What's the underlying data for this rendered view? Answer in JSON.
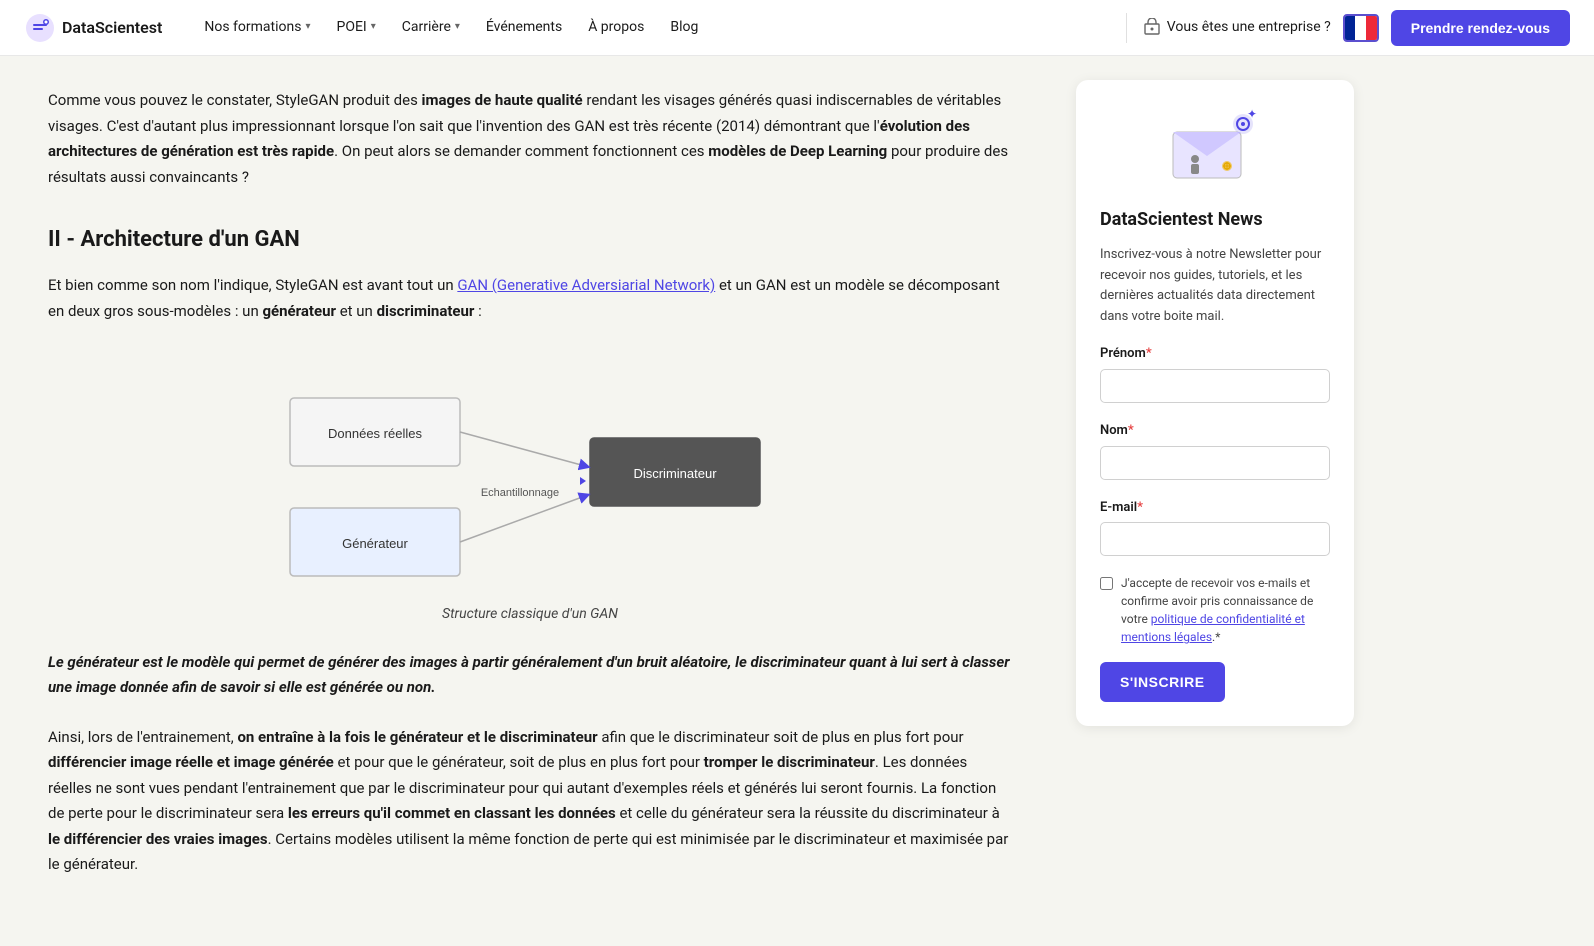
{
  "navbar": {
    "logo_text": "DataScientest",
    "nav_items": [
      {
        "label": "Nos formations",
        "has_dropdown": true
      },
      {
        "label": "POEI",
        "has_dropdown": true
      },
      {
        "label": "Carrière",
        "has_dropdown": true
      },
      {
        "label": "Événements",
        "has_dropdown": false
      },
      {
        "label": "À propos",
        "has_dropdown": false
      },
      {
        "label": "Blog",
        "has_dropdown": false
      }
    ],
    "enterprise_label": "Vous êtes une entreprise ?",
    "cta_label": "Prendre rendez-vous"
  },
  "article": {
    "intro": "Comme vous pouvez le constater, StyleGAN produit des images de haute qualité rendant les visages générés quasi indiscernables de véritables visages. C'est d'autant plus impressionnant lorsque l'on sait que l'invention des GAN est très récente (2014) démontrant que l'évolution des architectures de génération est très rapide. On peut alors se demander comment fonctionnent ces modèles de Deep Learning pour produire des résultats aussi convaincants ?",
    "section_title": "II - Architecture d'un GAN",
    "section_text_1_part1": "Et bien comme son nom l'indique, StyleGAN est avant tout un ",
    "section_text_1_link": "GAN (Generative Adversiarial Network)",
    "section_text_1_part2": " et un GAN est un modèle se décomposant en deux gros sous-modèles : un ",
    "section_text_1_bold1": "générateur",
    "section_text_1_mid": " et un ",
    "section_text_1_bold2": "discriminateur",
    "section_text_1_end": " :",
    "diagram": {
      "box1_label": "Données réelles",
      "box2_label": "Générateur",
      "box3_label": "Discriminateur",
      "arrow_label": "Echantillonnage",
      "caption": "Structure classique d'un GAN"
    },
    "bold_italic": "Le générateur est le modèle qui permet de générer des images à partir généralement d'un bruit aléatoire, le discriminateur quant à lui sert à classer une image donnée afin de savoir si elle est générée ou non.",
    "paragraph2": "Ainsi, lors de l'entrainement, on entraîne à la fois le générateur et le discriminateur afin que le discriminateur soit de plus en plus fort pour différencier image réelle et image générée et pour que le générateur, soit de plus en plus fort pour tromper le discriminateur. Les données réelles ne sont vues pendant l'entrainement que par le discriminateur pour qui autant d'exemples réels et générés lui seront fournis. La fonction de perte pour le discriminateur sera les erreurs qu'il commet en classant les données et celle du générateur sera la réussite du discriminateur à le différencier des vraies images. Certains modèles utilisent la même fonction de perte qui est minimisée par le discriminateur et maximisée par le générateur.",
    "paragraph2_bold_parts": [
      "on entraîne à la fois le générateur et le discriminateur",
      "différencier image réelle et image générée",
      "tromper le discriminateur",
      "les erreurs qu'il commet en classant les données",
      "le différencier des vraies images"
    ]
  },
  "sidebar": {
    "title": "DataScientest News",
    "description": "Inscrivez-vous à notre Newsletter pour recevoir nos guides, tutoriels, et les dernières actualités data directement dans votre boite mail.",
    "form": {
      "prenom_label": "Prénom",
      "prenom_required": true,
      "nom_label": "Nom",
      "nom_required": true,
      "email_label": "E-mail",
      "email_required": true,
      "checkbox_text": "J'accepte de recevoir vos e-mails et confirme avoir pris connaissance de votre politique de confidentialité et mentions légales.",
      "checkbox_required": true,
      "submit_label": "S'INSCRIRE"
    }
  }
}
